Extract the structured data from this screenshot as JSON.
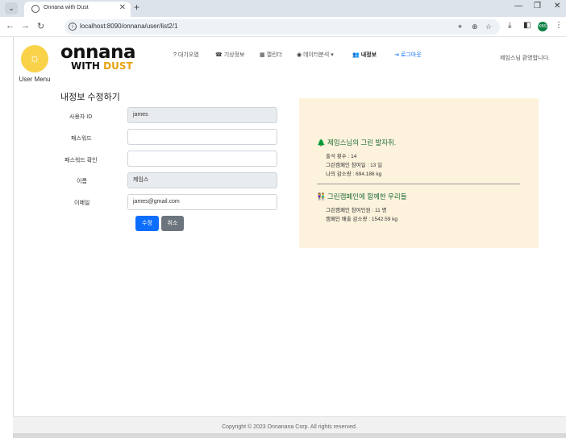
{
  "browser": {
    "tab_title": "Onnana with Dust",
    "url": "localhost:8090/onnana/user/list2/1",
    "new_tab": "+",
    "profile_badge": "KBS"
  },
  "side": {
    "user_menu_label": "User Menu"
  },
  "logo": {
    "line1": "onnana",
    "line2_a": "WITH ",
    "line2_b": "DUST"
  },
  "nav": [
    {
      "icon": "?",
      "label": "대기오염"
    },
    {
      "icon": "☎",
      "label": "기상정보"
    },
    {
      "icon": "▦",
      "label": "캘린더"
    },
    {
      "icon": "◉",
      "label": "데이터분석 ▾"
    },
    {
      "icon": "👥",
      "label": "내정보"
    },
    {
      "icon": "⇥",
      "label": "로그아웃"
    }
  ],
  "welcome": "제임스님 환영합니다.",
  "form": {
    "title": "내정보 수정하기",
    "labels": {
      "id": "사용자 ID",
      "pw": "패스워드",
      "pw_confirm": "패스워드 확인",
      "name": "이름",
      "email": "이메일"
    },
    "values": {
      "id": "james",
      "pw": "",
      "pw_confirm": "",
      "name": "제임스",
      "email": "james@gmail.com"
    },
    "save_label": "수정",
    "cancel_label": "취소"
  },
  "panel": {
    "heading1": "🌲 제임스님의 그린 발자취.",
    "stat1": "출석 횟수 : 14",
    "stat2": "그린캠페인 참여일 : 13 일",
    "stat3": "나의 감소량 : 694.186 kg",
    "heading2": "👫 그린캠페인에 함께한 우리들",
    "stat4": "그린캠페인 참여인원 : 11 명",
    "stat5": "캠페인 배출 감소량 : 1542.59 kg"
  },
  "footer": "Copyright © 2023 Onnanana Corp. All rights reserved."
}
